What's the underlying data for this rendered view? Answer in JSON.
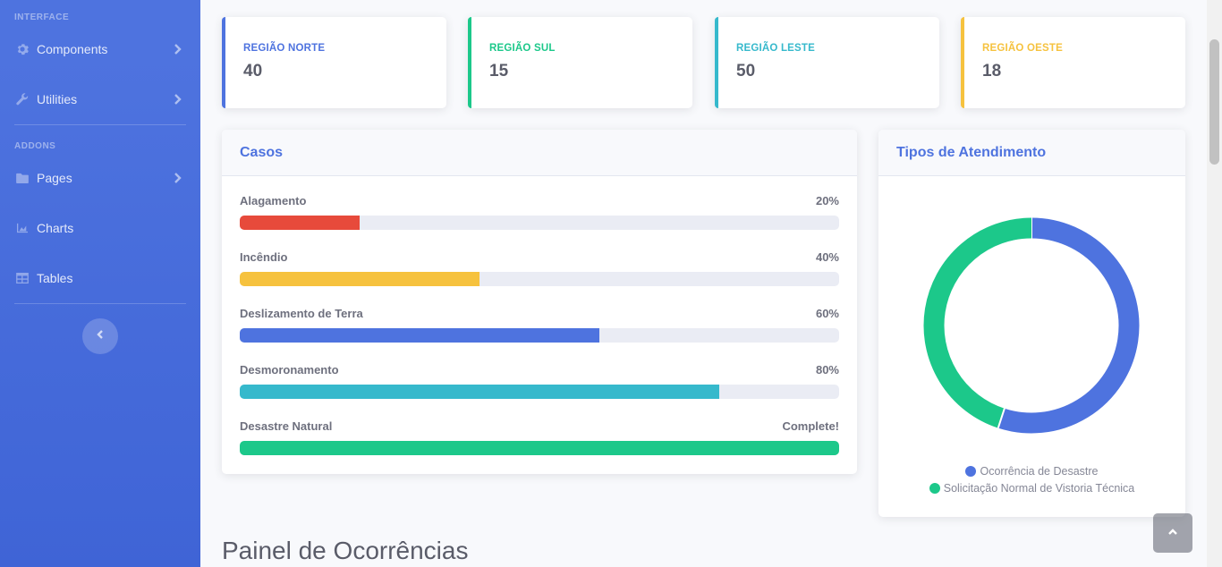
{
  "sidebar": {
    "heading_interface": "Interface",
    "heading_addons": "Addons",
    "items": [
      {
        "label": "Components",
        "icon": "gear-icon"
      },
      {
        "label": "Utilities",
        "icon": "wrench-icon"
      },
      {
        "label": "Pages",
        "icon": "folder-icon"
      },
      {
        "label": "Charts",
        "icon": "chart-area-icon"
      },
      {
        "label": "Tables",
        "icon": "table-icon"
      }
    ]
  },
  "stats": [
    {
      "label": "Região Norte",
      "value": "40",
      "color": "#4e73df"
    },
    {
      "label": "Região Sul",
      "value": "15",
      "color": "#1cc88a"
    },
    {
      "label": "Região Leste",
      "value": "50",
      "color": "#36b9cc"
    },
    {
      "label": "Região Oeste",
      "value": "18",
      "color": "#f6c23e"
    }
  ],
  "casos": {
    "title": "Casos",
    "rows": [
      {
        "name": "Alagamento",
        "label": "20%",
        "value": 20,
        "color": "#e74a3b"
      },
      {
        "name": "Incêndio",
        "label": "40%",
        "value": 40,
        "color": "#f6c23e"
      },
      {
        "name": "Deslizamento de Terra",
        "label": "60%",
        "value": 60,
        "color": "#4e73df"
      },
      {
        "name": "Desmoronamento",
        "label": "80%",
        "value": 80,
        "color": "#36b9cc"
      },
      {
        "name": "Desastre Natural",
        "label": "Complete!",
        "value": 100,
        "color": "#1cc88a"
      }
    ]
  },
  "atendimento": {
    "title": "Tipos de Atendimento"
  },
  "chart_data": {
    "type": "pie",
    "donut": true,
    "categories": [
      "Ocorrência de Desastre",
      "Solicitação Normal de Vistoria Técnica"
    ],
    "values": [
      55,
      45
    ],
    "colors": [
      "#4e73df",
      "#1cc88a"
    ],
    "legend": "bottom"
  },
  "page_heading": "Painel de Ocorrências"
}
